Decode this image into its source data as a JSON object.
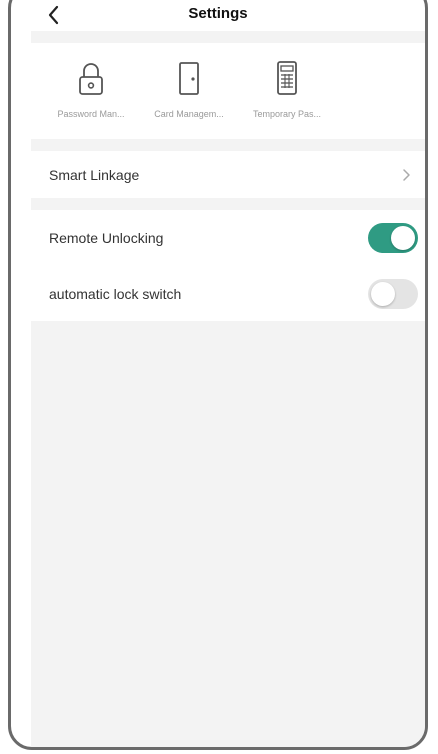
{
  "header": {
    "title": "Settings",
    "back_icon": "chevron-left-icon"
  },
  "quick_actions": [
    {
      "label": "Password Man...",
      "icon": "lock-icon"
    },
    {
      "label": "Card Managem...",
      "icon": "door-icon"
    },
    {
      "label": "Temporary Pas...",
      "icon": "keypad-icon"
    }
  ],
  "smart_linkage": {
    "label": "Smart Linkage",
    "icon": "chevron-right-icon"
  },
  "toggles": [
    {
      "label": "Remote Unlocking",
      "state": "on"
    },
    {
      "label": "automatic lock switch",
      "state": "off"
    }
  ],
  "colors": {
    "accent": "#2f9b83",
    "section_bg": "#f3f3f3",
    "toggle_off": "#e4e4e4"
  }
}
